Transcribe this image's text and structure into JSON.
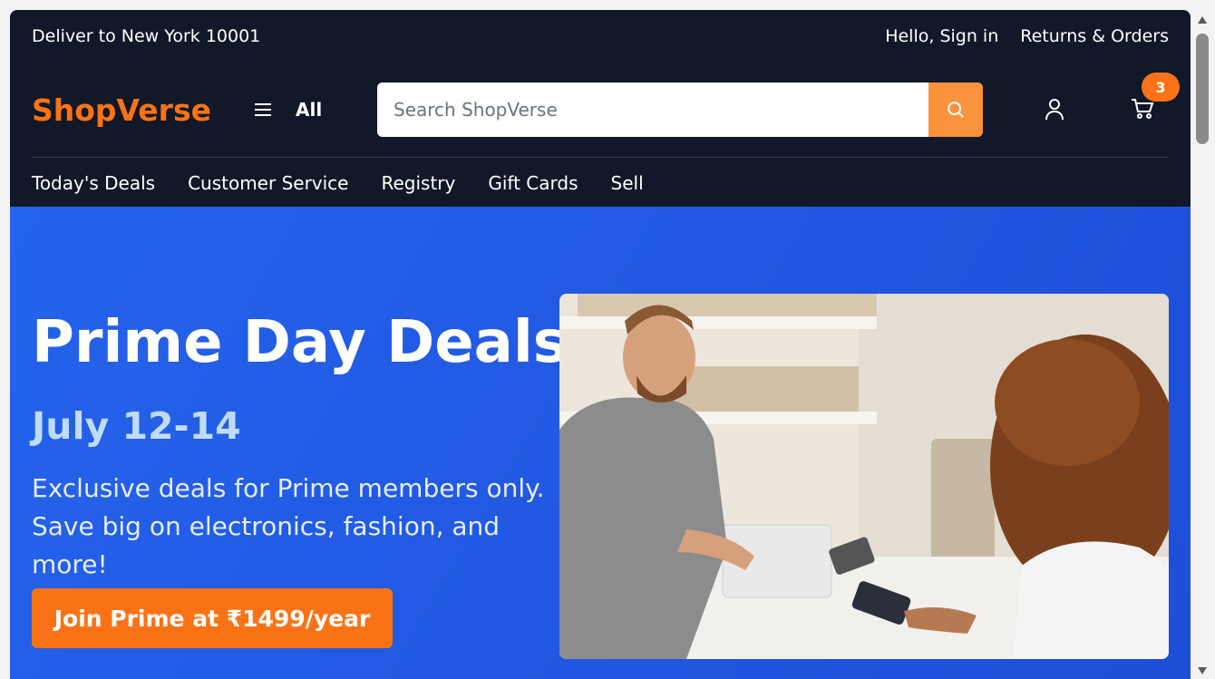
{
  "topbar": {
    "deliver": "Deliver to New York 10001",
    "signin": "Hello, Sign in",
    "orders": "Returns & Orders"
  },
  "header": {
    "logo": "ShopVerse",
    "all_label": "All",
    "search_placeholder": "Search ShopVerse",
    "cart_count": "3"
  },
  "nav": {
    "items": [
      "Today's Deals",
      "Customer Service",
      "Registry",
      "Gift Cards",
      "Sell"
    ]
  },
  "hero": {
    "title": "Prime Day Deals",
    "dates": "July 12-14",
    "line1": "Exclusive deals for Prime members only.",
    "line2": "Save big on electronics, fashion, and more!",
    "cta": "Join Prime at ₹1499/year"
  },
  "colors": {
    "brand": "#f97316",
    "header_bg": "#111827",
    "hero_bg": "#2563eb"
  }
}
